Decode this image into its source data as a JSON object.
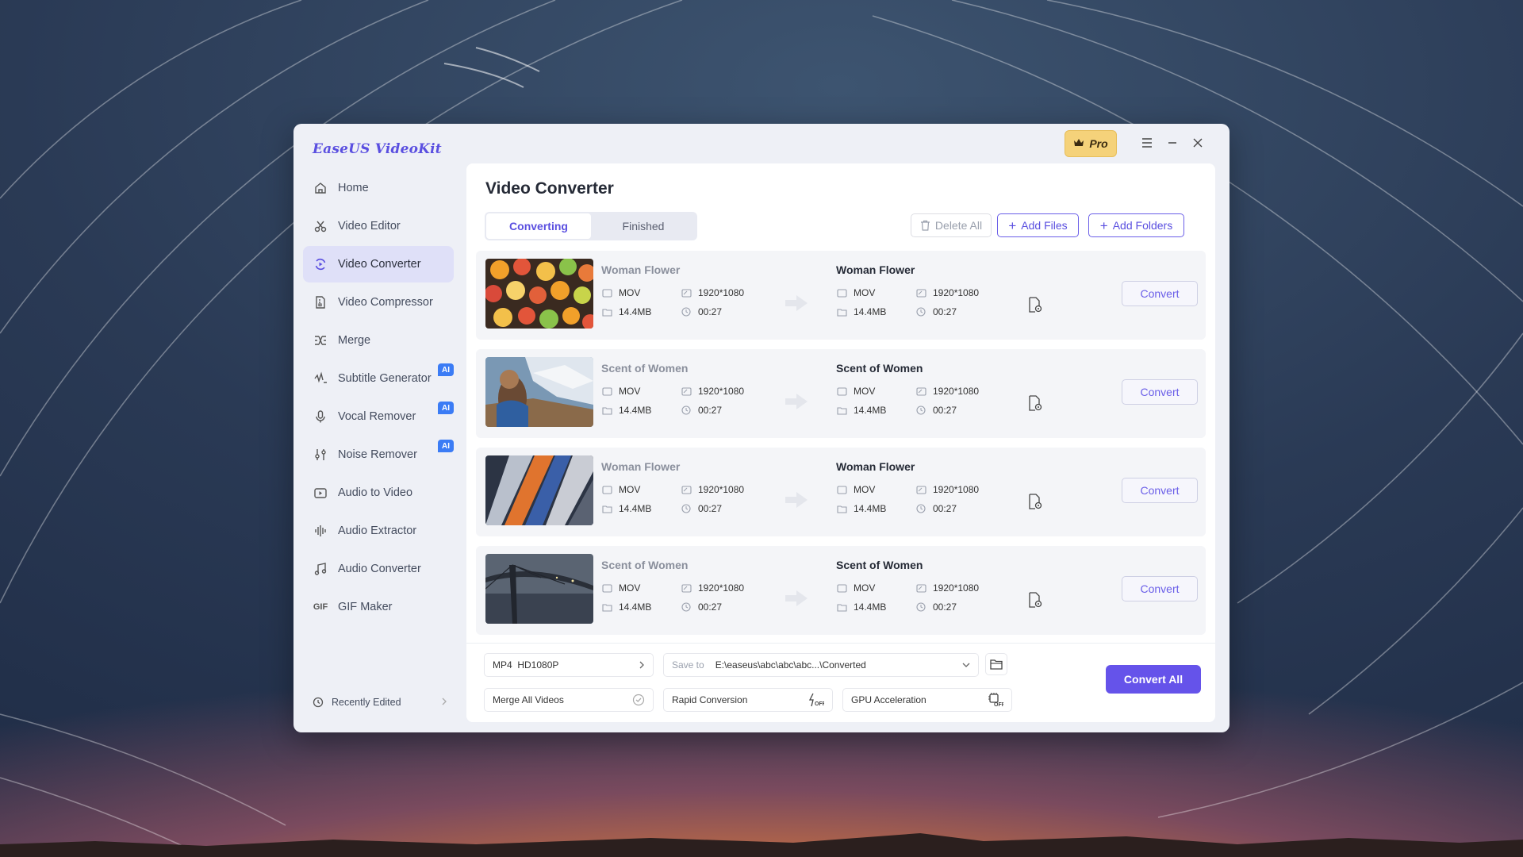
{
  "app": {
    "logo": "EaseUS VideoKit",
    "pro_label": "Pro"
  },
  "sidebar": {
    "items": [
      {
        "label": "Home",
        "icon": "home-icon"
      },
      {
        "label": "Video Editor",
        "icon": "scissors-icon"
      },
      {
        "label": "Video Converter",
        "icon": "convert-icon",
        "active": true
      },
      {
        "label": "Video Compressor",
        "icon": "compress-icon"
      },
      {
        "label": "Merge",
        "icon": "merge-icon"
      },
      {
        "label": "Subtitle Generator",
        "icon": "subtitle-icon",
        "badge": "AI"
      },
      {
        "label": "Vocal Remover",
        "icon": "microphone-icon",
        "badge": "AI"
      },
      {
        "label": "Noise Remover",
        "icon": "sliders-icon",
        "badge": "AI"
      },
      {
        "label": "Audio to Video",
        "icon": "video-icon"
      },
      {
        "label": "Audio Extractor",
        "icon": "waveform-icon"
      },
      {
        "label": "Audio Converter",
        "icon": "music-note-icon"
      },
      {
        "label": "GIF Maker",
        "icon": "gif-icon"
      }
    ],
    "recently_edited": "Recently Edited"
  },
  "main": {
    "title": "Video Converter",
    "tabs": [
      {
        "label": "Converting",
        "active": true
      },
      {
        "label": "Finished"
      }
    ],
    "delete_all": "Delete All",
    "add_files": "Add Files",
    "add_folders": "Add Folders",
    "convert_label": "Convert",
    "files": [
      {
        "name": "Woman Flower",
        "format": "MOV",
        "resolution": "1920*1080",
        "size": "14.4MB",
        "duration": "00:27",
        "out_name": "Woman Flower",
        "out_format": "MOV",
        "out_resolution": "1920*1080",
        "out_size": "14.4MB",
        "out_duration": "00:27"
      },
      {
        "name": "Scent of Women",
        "format": "MOV",
        "resolution": "1920*1080",
        "size": "14.4MB",
        "duration": "00:27",
        "out_name": "Scent of Women",
        "out_format": "MOV",
        "out_resolution": "1920*1080",
        "out_size": "14.4MB",
        "out_duration": "00:27"
      },
      {
        "name": "Woman Flower",
        "format": "MOV",
        "resolution": "1920*1080",
        "size": "14.4MB",
        "duration": "00:27",
        "out_name": "Woman Flower",
        "out_format": "MOV",
        "out_resolution": "1920*1080",
        "out_size": "14.4MB",
        "out_duration": "00:27"
      },
      {
        "name": "Scent of Women",
        "format": "MOV",
        "resolution": "1920*1080",
        "size": "14.4MB",
        "duration": "00:27",
        "out_name": "Scent of Women",
        "out_format": "MOV",
        "out_resolution": "1920*1080",
        "out_size": "14.4MB",
        "out_duration": "00:27"
      }
    ]
  },
  "footer": {
    "output_format": "MP4  HD1080P",
    "save_to_label": "Save to",
    "save_to_path": "E:\\easeus\\abc\\abc\\abc...\\Converted",
    "merge_all": "Merge All Videos",
    "rapid_conversion": "Rapid Conversion",
    "gpu_acceleration": "GPU Acceleration",
    "convert_all": "Convert All"
  },
  "colors": {
    "accent": "#5a4fe0",
    "primary_button": "#6553ea",
    "ai_badge": "#3b7cf5",
    "pro_badge": "#f5d27a"
  }
}
